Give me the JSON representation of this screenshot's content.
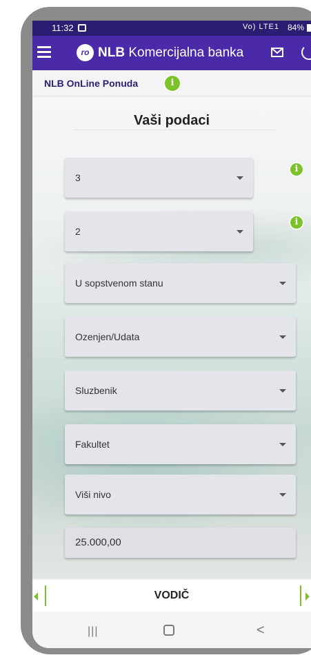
{
  "status_bar": {
    "time": "11:32",
    "signal_text": "Vo) LTE1",
    "battery": "84%"
  },
  "app_bar": {
    "logo_mark": "ro",
    "bank_bold": "NLB",
    "bank_rest": " Komercijalna banka"
  },
  "subheader": {
    "title": "NLB OnLine Ponuda",
    "info_glyph": "i"
  },
  "section": {
    "title": "Vaši podaci"
  },
  "fields": [
    {
      "value": "3",
      "kind": "select"
    },
    {
      "value": "2",
      "kind": "select"
    },
    {
      "value": "U sopstvenom stanu",
      "kind": "select"
    },
    {
      "value": "Ozenjen/Udata",
      "kind": "select"
    },
    {
      "value": "Sluzbenik",
      "kind": "select"
    },
    {
      "value": "Fakultet",
      "kind": "select"
    },
    {
      "value": "Viši nivo",
      "kind": "select"
    },
    {
      "value": "25.000,00",
      "kind": "input"
    }
  ],
  "info_glyph": "i",
  "guide": {
    "label": "VODIČ"
  },
  "nav": {
    "recent_glyph": "|||",
    "back_glyph": "<"
  },
  "colors": {
    "status_bar": "#2a1e72",
    "app_bar": "#4a2aa8",
    "accent_green": "#7cc22b"
  }
}
